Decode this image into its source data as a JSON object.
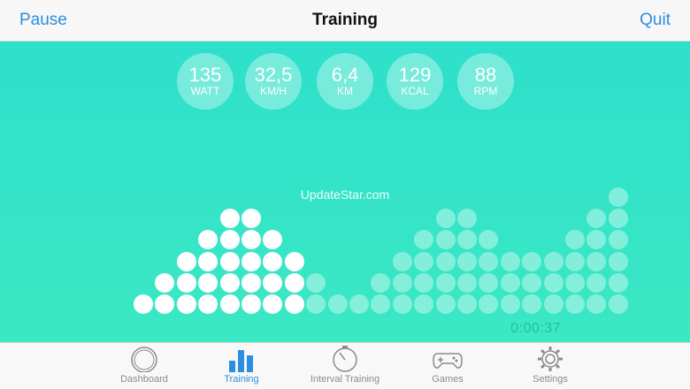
{
  "nav": {
    "left_label": "Pause",
    "title": "Training",
    "right_label": "Quit"
  },
  "stats": [
    {
      "value": "135",
      "unit": "WATT"
    },
    {
      "value": "32,5",
      "unit": "KM/H"
    },
    {
      "value": "6,4",
      "unit": "KM"
    },
    {
      "value": "129",
      "unit": "KCAL"
    },
    {
      "value": "88",
      "unit": "RPM"
    }
  ],
  "watermark": "UpdateStar.com",
  "timer": "0:00:37",
  "profile": {
    "column_heights": [
      1,
      2,
      3,
      4,
      5,
      5,
      4,
      3,
      2,
      1,
      1,
      2,
      3,
      4,
      5,
      5,
      4,
      3,
      3,
      3,
      4,
      5,
      6
    ],
    "completed_columns": 8
  },
  "tabs": [
    {
      "label": "Dashboard",
      "icon": "dashboard-gauge-icon",
      "active": false
    },
    {
      "label": "Training",
      "icon": "bar-chart-icon",
      "active": true
    },
    {
      "label": "Interval Training",
      "icon": "stopwatch-icon",
      "active": false
    },
    {
      "label": "Games",
      "icon": "gamepad-icon",
      "active": false
    },
    {
      "label": "Settings",
      "icon": "gear-icon",
      "active": false
    }
  ],
  "colors": {
    "accent": "#2a8fe0",
    "background": "#2ee0cb",
    "timer": "#20c0a6"
  }
}
